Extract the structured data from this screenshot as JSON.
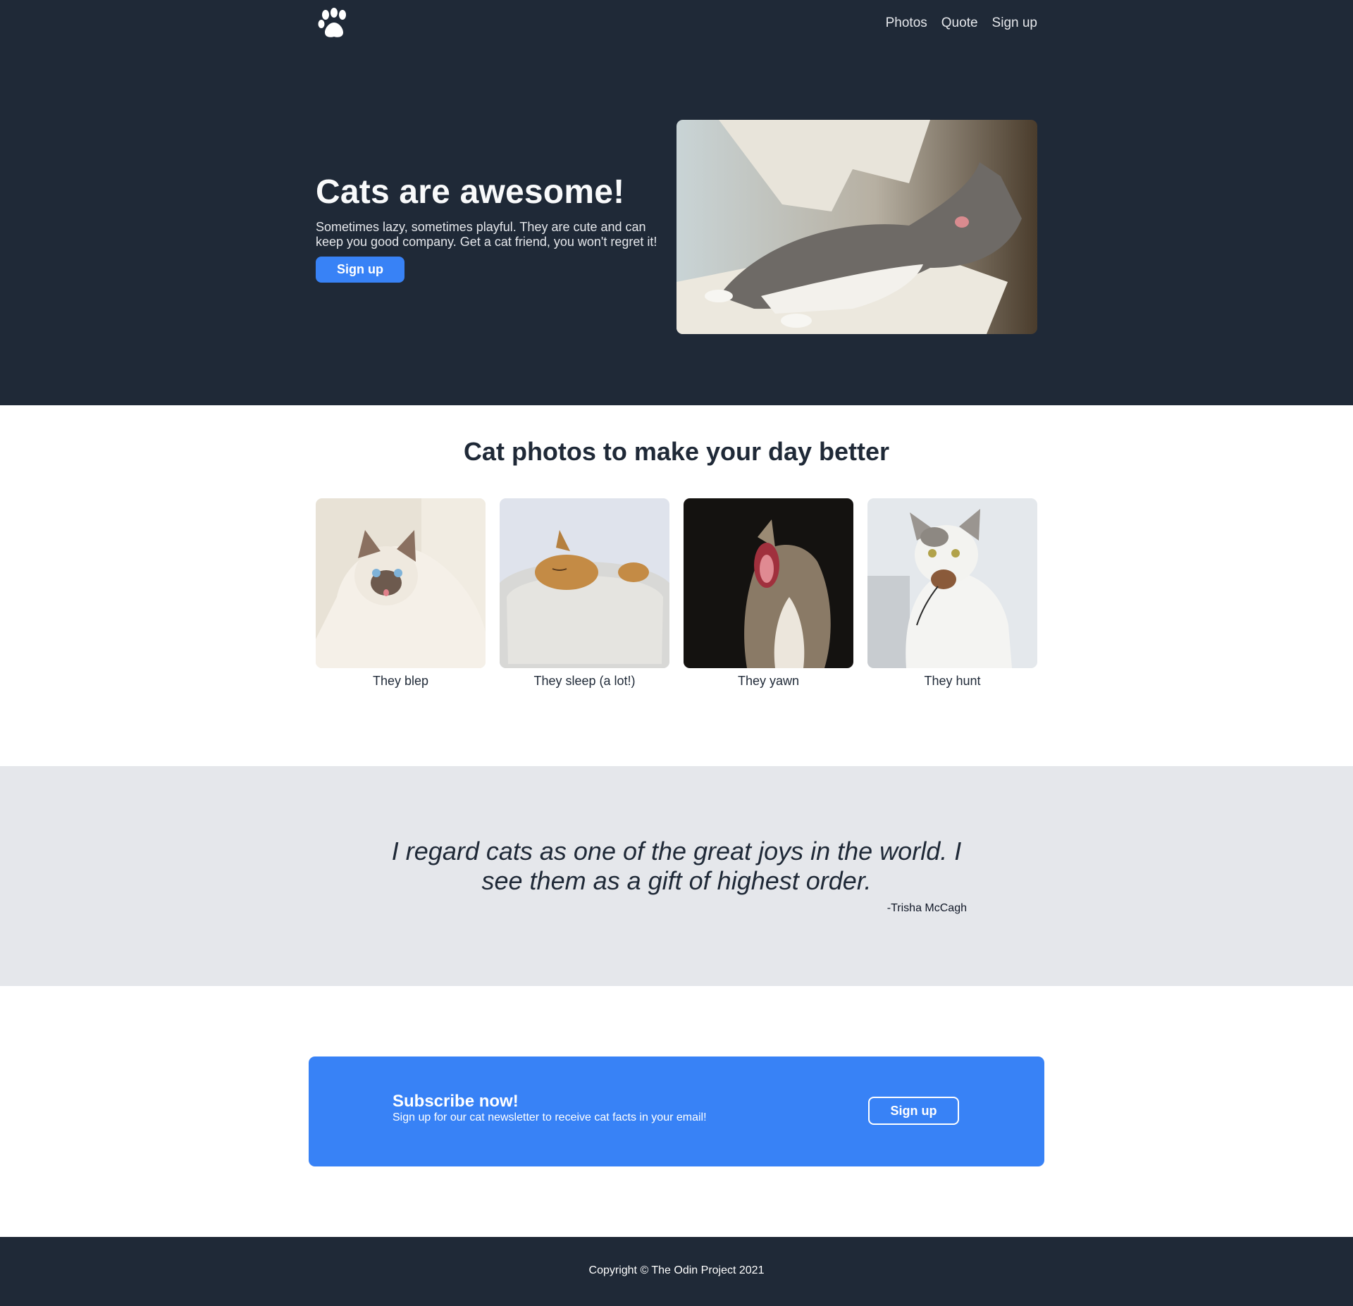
{
  "colors": {
    "dark": "#1f2937",
    "accent": "#3882f6",
    "light_gray": "#e5e7eb",
    "white": "#ffffff"
  },
  "header": {
    "logo_icon": "paw-icon",
    "nav": [
      {
        "label": "Photos"
      },
      {
        "label": "Quote"
      },
      {
        "label": "Sign up"
      }
    ]
  },
  "hero": {
    "title": "Cats are awesome!",
    "subtitle": "Sometimes lazy, sometimes playful. They are cute and can keep you good company. Get a cat friend, you won't regret it!",
    "button_label": "Sign up",
    "image_icon": "cat-photo"
  },
  "photos": {
    "title": "Cat photos to make your day better",
    "items": [
      {
        "caption": "They blep"
      },
      {
        "caption": "They sleep (a lot!)"
      },
      {
        "caption": "They yawn"
      },
      {
        "caption": "They hunt"
      }
    ]
  },
  "quote": {
    "text": "I regard cats as one of the great joys in the world. I see them as a gift of highest order.",
    "author": "-Trisha McCagh"
  },
  "cta": {
    "title": "Subscribe now!",
    "subtitle": "Sign up for our cat newsletter to receive cat facts in your email!",
    "button_label": "Sign up"
  },
  "footer": {
    "copyright": "Copyright © The Odin Project 2021"
  }
}
